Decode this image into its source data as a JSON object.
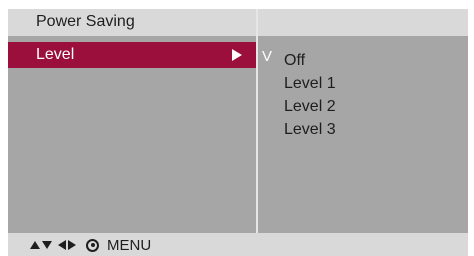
{
  "osd": {
    "title": "Power Saving",
    "selected_item": {
      "label": "Level",
      "arrow_icon": "right-arrow-icon"
    },
    "options": [
      {
        "label": "Off",
        "checked": true
      },
      {
        "label": "Level 1",
        "checked": false
      },
      {
        "label": "Level 2",
        "checked": false
      },
      {
        "label": "Level 3",
        "checked": false
      }
    ],
    "check_mark": "V",
    "footer": {
      "icons": [
        "up-arrow-icon",
        "down-arrow-icon",
        "left-arrow-icon",
        "right-arrow-icon",
        "ok-button-icon"
      ],
      "menu_label": "MENU"
    },
    "colors": {
      "panel": "#a6a6a6",
      "bars": "#d9d9d9",
      "highlight": "#9b0f3c"
    }
  }
}
